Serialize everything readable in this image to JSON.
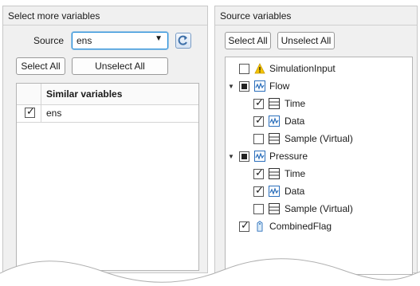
{
  "left_panel": {
    "title": "Select more variables",
    "source_label": "Source",
    "source_value": "ens",
    "select_all_label": "Select All",
    "unselect_all_label": "Unselect All",
    "table": {
      "header": "Similar variables",
      "rows": [
        {
          "name": "ens",
          "checked": true
        }
      ]
    }
  },
  "right_panel": {
    "title": "Source variables",
    "select_all_label": "Select All",
    "unselect_all_label": "Unselect All",
    "tree": [
      {
        "label": "SimulationInput",
        "icon": "warning-icon",
        "state": "unchecked"
      },
      {
        "label": "Flow",
        "icon": "signal-icon",
        "state": "partial",
        "expanded": true,
        "children": [
          {
            "label": "Time",
            "icon": "table-icon",
            "state": "checked"
          },
          {
            "label": "Data",
            "icon": "signal-icon",
            "state": "checked"
          },
          {
            "label": "Sample (Virtual)",
            "icon": "table-icon",
            "state": "unchecked"
          }
        ]
      },
      {
        "label": "Pressure",
        "icon": "signal-icon",
        "state": "partial",
        "expanded": true,
        "children": [
          {
            "label": "Time",
            "icon": "table-icon",
            "state": "checked"
          },
          {
            "label": "Data",
            "icon": "signal-icon",
            "state": "checked"
          },
          {
            "label": "Sample (Virtual)",
            "icon": "table-icon",
            "state": "unchecked"
          }
        ]
      },
      {
        "label": "CombinedFlag",
        "icon": "tag-icon",
        "state": "checked"
      }
    ]
  },
  "colors": {
    "accent": "#1f8ad8",
    "panel_bg": "#f0f0f0",
    "warning": "#f5c400",
    "signal_icon": "#2a6ebb"
  }
}
